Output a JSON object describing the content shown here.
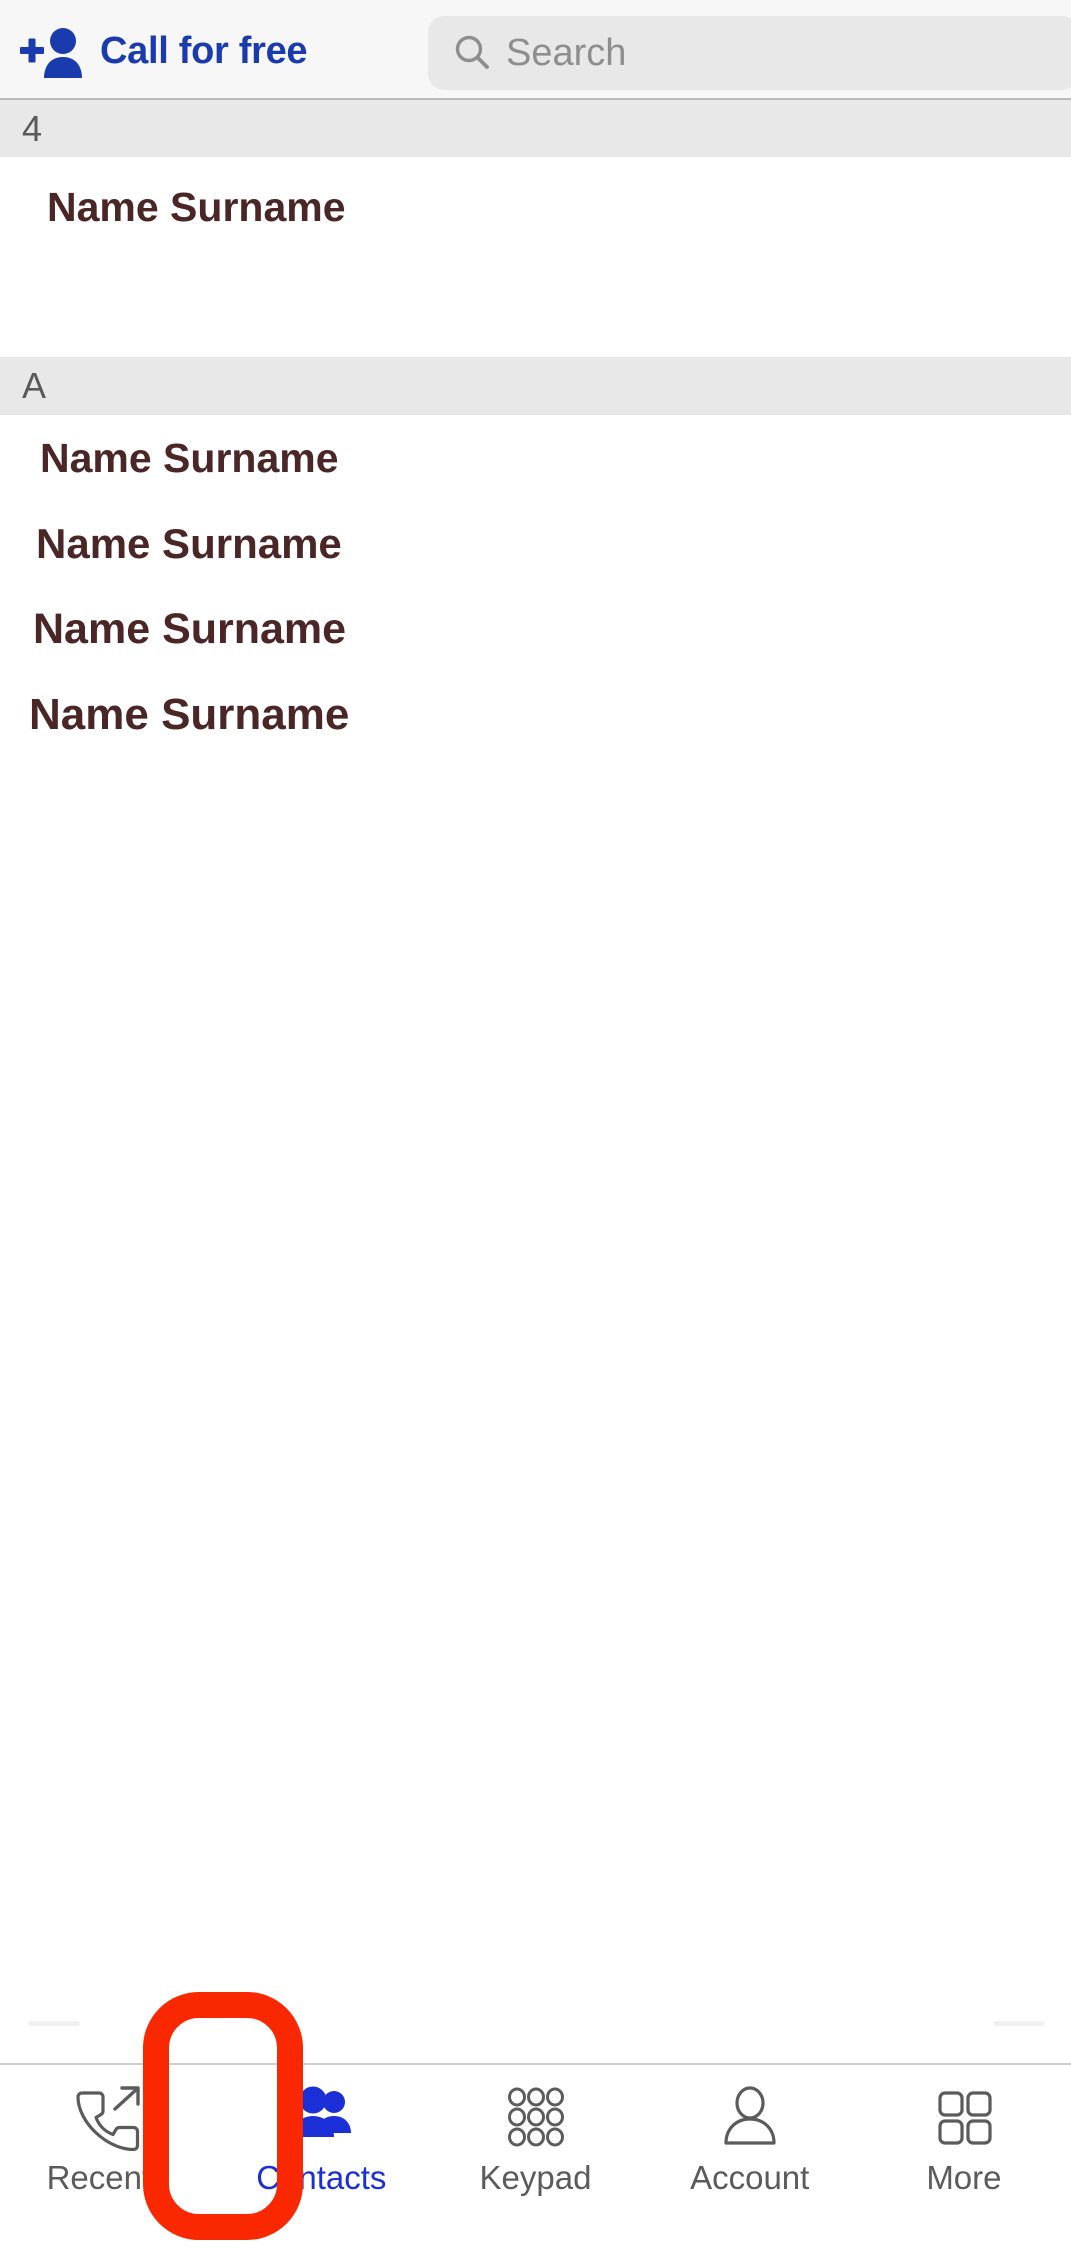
{
  "header": {
    "call_for_free_label": "Call for free",
    "add_person_icon": "add-person-icon",
    "search": {
      "placeholder": "Search",
      "value": "",
      "icon": "search-icon"
    }
  },
  "contacts": {
    "sections": [
      {
        "title": "4",
        "rows": [
          {
            "name": "Name Surname"
          }
        ]
      },
      {
        "title": "A",
        "rows": [
          {
            "name": "Name Surname"
          },
          {
            "name": "Name Surname"
          },
          {
            "name": "Name Surname"
          },
          {
            "name": "Name Surname"
          }
        ]
      }
    ]
  },
  "tabbar": {
    "items": [
      {
        "label": "Recents",
        "icon": "phone-outgoing-icon",
        "active": false
      },
      {
        "label": "Contacts",
        "icon": "people-icon",
        "active": true
      },
      {
        "label": "Keypad",
        "icon": "dialpad-icon",
        "active": false
      },
      {
        "label": "Account",
        "icon": "person-outline-icon",
        "active": false
      },
      {
        "label": "More",
        "icon": "grid-squares-icon",
        "active": false
      }
    ]
  },
  "colors": {
    "accent_blue": "#1a3bad",
    "tab_active_blue": "#1a2fd6",
    "highlight_red": "#fa2800",
    "contact_name": "#4a2626",
    "section_header_bg": "#e8e8e8",
    "section_header_text": "#5a5a5a",
    "search_bg": "#e8e8e8",
    "topbar_bg": "#f7f7f7"
  }
}
